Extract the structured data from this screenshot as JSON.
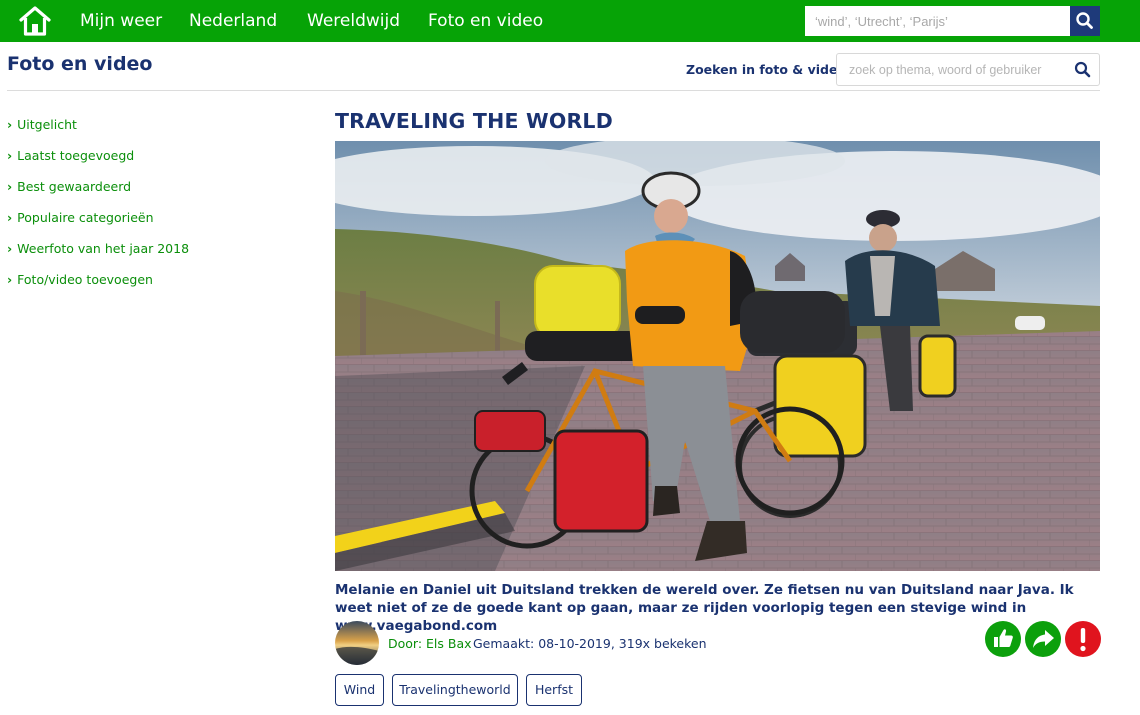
{
  "topnav": {
    "home_icon": "home-icon",
    "links": [
      "Mijn weer",
      "Nederland",
      "Wereldwijd",
      "Foto en video"
    ],
    "search_placeholder": "‘wind’, ‘Utrecht’, ‘Parijs’",
    "search_icon": "search-icon",
    "bar_color": "#06a306",
    "search_button_color": "#1e3a7a"
  },
  "header": {
    "title": "Foto en video",
    "search_label": "Zoeken in foto & video:",
    "search_placeholder": "zoek op thema, woord of gebruiker",
    "search_icon": "search-icon"
  },
  "sidebar": {
    "chevron": "›",
    "items": [
      "Uitgelicht",
      "Laatst toegevoegd",
      "Best gewaardeerd",
      "Populaire categorieën",
      "Weerfoto van het jaar 2018",
      "Foto/video toevoegen"
    ]
  },
  "photo": {
    "title": "TRAVELING THE WORLD",
    "caption": "Melanie en Daniel uit Duitsland trekken de wereld over. Ze fietsen nu van Duitsland naar Java. Ik weet niet of ze de goede kant op gaan, maar ze rijden voorlopig tegen een stevige wind in www.vaegabond.com",
    "author": "Door: Els Bax",
    "meta": "Gemaakt: 08-10-2019, 319x bekeken",
    "actions": [
      "thumbs-up-icon",
      "share-icon",
      "report-icon"
    ],
    "tags": [
      "Wind",
      "Travelingtheworld",
      "Herfst"
    ]
  },
  "colors": {
    "brand_green": "#06a306",
    "link_green": "#0b8f0b",
    "navy": "#1a3270",
    "report_red": "#e0141e"
  }
}
